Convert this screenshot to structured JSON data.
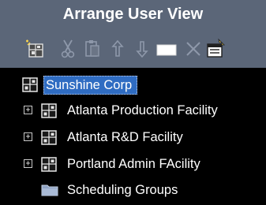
{
  "header": {
    "title": "Arrange User View"
  },
  "toolbar": {
    "items": [
      {
        "name": "new-org-icon"
      },
      {
        "name": "cut-icon"
      },
      {
        "name": "paste-icon"
      },
      {
        "name": "move-up-icon"
      },
      {
        "name": "move-down-icon"
      },
      {
        "name": "rename-icon"
      },
      {
        "name": "delete-icon"
      },
      {
        "name": "properties-icon"
      }
    ]
  },
  "tree": {
    "root": {
      "label": "Sunshine Corp"
    },
    "children": [
      {
        "label": "Atlanta Production Facility",
        "expander": "+"
      },
      {
        "label": "Atlanta R&D Facility",
        "expander": "+"
      },
      {
        "label": "Portland Admin FAcility",
        "expander": "+"
      },
      {
        "label": "Scheduling Groups"
      }
    ]
  },
  "colors": {
    "header_bg": "#5b6678",
    "tree_bg": "#000000",
    "selection": "#2f6cc2"
  }
}
